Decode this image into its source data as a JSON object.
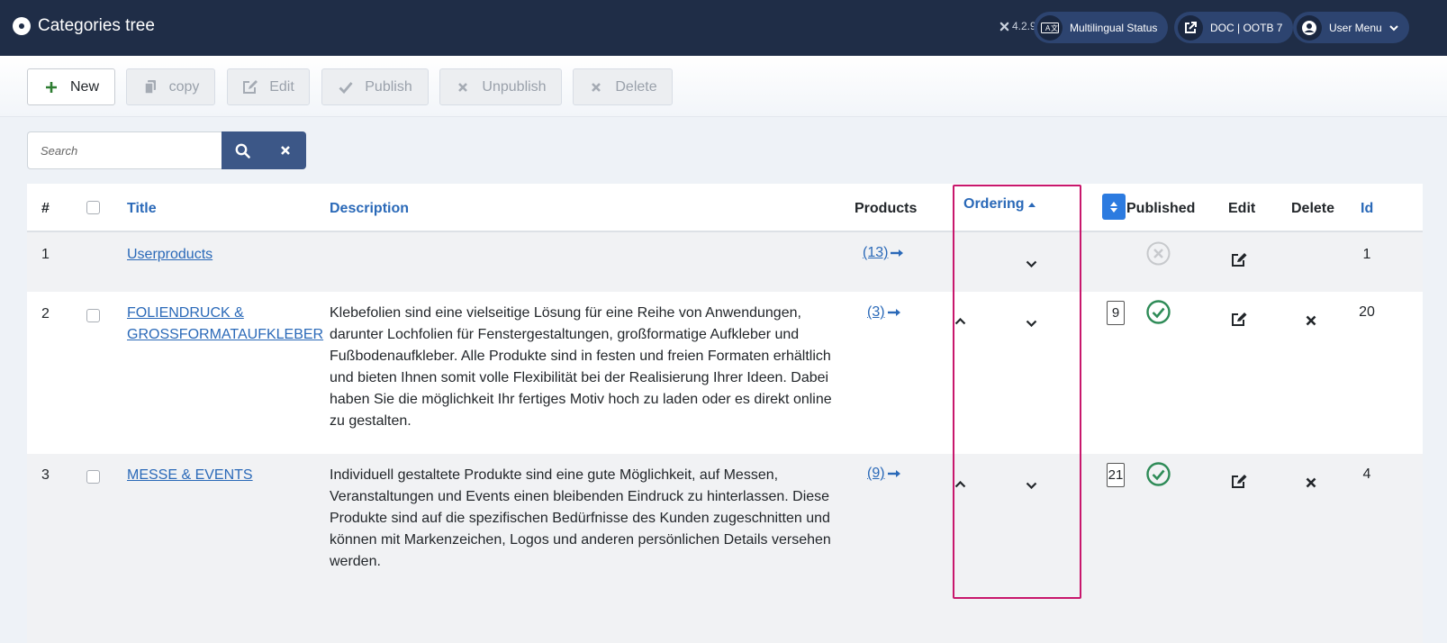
{
  "header": {
    "title": "Categories tree",
    "version": "4.2.9",
    "buttons": [
      {
        "label": "Multilingual Status",
        "icon": "language-icon"
      },
      {
        "label": "DOC | OOTB 7",
        "icon": "external-link-icon"
      },
      {
        "label": "User Menu",
        "icon": "user-icon"
      }
    ]
  },
  "toolbar": {
    "new": "New",
    "copy": "copy",
    "edit": "Edit",
    "publish": "Publish",
    "unpublish": "Unpublish",
    "delete": "Delete"
  },
  "search": {
    "placeholder": "Search",
    "value": ""
  },
  "table": {
    "columns": {
      "number": "#",
      "title": "Title",
      "description": "Description",
      "products": "Products",
      "ordering": "Ordering",
      "published": "Published",
      "edit": "Edit",
      "delete": "Delete",
      "id": "Id"
    },
    "rows": [
      {
        "number": "1",
        "title": "Userproducts",
        "description": "",
        "products": "(13)",
        "order": "",
        "published": false,
        "id": "1"
      },
      {
        "number": "2",
        "title": "FOLIENDRUCK & GROSSFORMATAUFKLEBER",
        "description": "Klebefolien sind eine vielseitige Lösung für eine Reihe von Anwendungen, darunter Lochfolien für Fenstergestaltungen, großformatige Aufkleber und Fußbodenaufkleber. Alle Produkte sind in festen und freien Formaten erhältlich und bieten Ihnen somit volle Flexibilität bei der Realisierung Ihrer Ideen. Dabei haben Sie die möglichkeit Ihr fertiges Motiv hoch zu laden oder es direkt online zu gestalten.",
        "products": "(3)",
        "order": "9",
        "published": true,
        "id": "20"
      },
      {
        "number": "3",
        "title": "MESSE & EVENTS",
        "description": "Individuell gestaltete Produkte sind eine gute Möglichkeit, auf Messen, Veranstaltungen und Events einen bleibenden Eindruck zu hinterlassen. Diese Produkte sind auf die spezifischen Bedürfnisse des Kunden zugeschnitten und können mit Markenzeichen, Logos und anderen persönlichen Details versehen werden.",
        "products": "(9)",
        "order": "21",
        "published": true,
        "id": "4"
      }
    ]
  },
  "colors": {
    "header_bg": "#1f2d47",
    "link": "#2a69b8",
    "published_green": "#2e8b57",
    "highlight": "#c8176c"
  }
}
